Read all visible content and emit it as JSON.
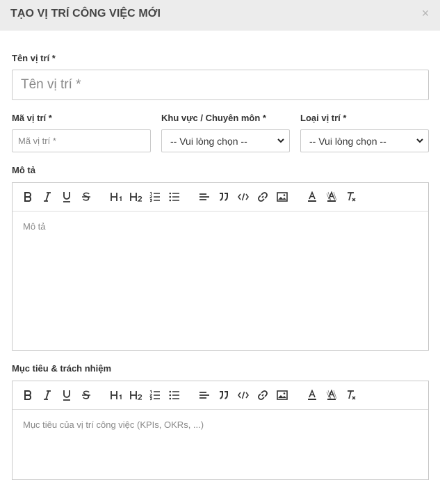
{
  "modal": {
    "title": "TẠO VỊ TRÍ CÔNG VIỆC MỚI",
    "close_glyph": "×"
  },
  "form": {
    "position_name": {
      "label": "Tên vị trí *",
      "placeholder": "Tên vị trí *"
    },
    "position_code": {
      "label": "Mã vị trí *",
      "placeholder": "Mã vị trí *"
    },
    "area": {
      "label": "Khu vực / Chuyên môn *",
      "selected": "-- Vui lòng chọn --"
    },
    "position_type": {
      "label": "Loại vị trí *",
      "selected": "-- Vui lòng chọn --"
    },
    "description": {
      "label": "Mô tả",
      "placeholder": "Mô tả"
    },
    "goals": {
      "label": "Mục tiêu & trách nhiệm",
      "placeholder": "Mục tiêu của vị trí công việc (KPIs, OKRs, ...)"
    }
  },
  "toolbar": {
    "items": [
      "bold-icon",
      "italic-icon",
      "underline-icon",
      "strikethrough-icon",
      "heading-1-icon",
      "heading-2-icon",
      "ordered-list-icon",
      "bullet-list-icon",
      "align-left-icon",
      "blockquote-icon",
      "code-icon",
      "link-icon",
      "image-icon",
      "text-color-icon",
      "background-color-icon",
      "clear-format-icon"
    ]
  },
  "colors": {
    "header_bg": "#ececec",
    "border": "#c9c9c9",
    "text": "#333333",
    "placeholder": "#888888"
  }
}
